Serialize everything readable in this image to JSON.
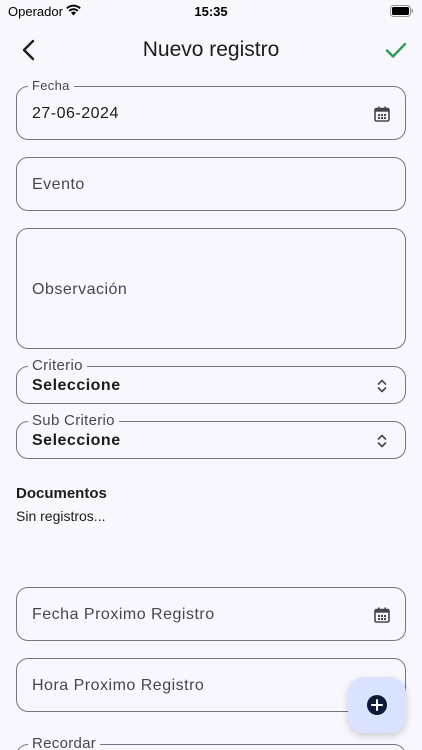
{
  "status_bar": {
    "carrier": "Operador",
    "time": "15:35"
  },
  "nav": {
    "title": "Nuevo registro"
  },
  "form": {
    "fecha": {
      "label": "Fecha",
      "value": "27-06-2024"
    },
    "evento": {
      "placeholder": "Evento"
    },
    "observacion": {
      "placeholder": "Observación"
    },
    "criterio": {
      "label": "Criterio",
      "value": "Seleccione"
    },
    "sub_criterio": {
      "label": "Sub Criterio",
      "value": "Seleccione"
    },
    "fecha_proximo": {
      "placeholder": "Fecha Proximo Registro"
    },
    "hora_proximo": {
      "placeholder": "Hora Proximo Registro"
    },
    "recordar": {
      "label": "Recordar"
    }
  },
  "documentos": {
    "title": "Documentos",
    "empty_text": "Sin registros..."
  },
  "colors": {
    "accent_check": "#2e9e4e",
    "fab_bg": "#d9e2ff",
    "background": "#f8f7fd"
  }
}
